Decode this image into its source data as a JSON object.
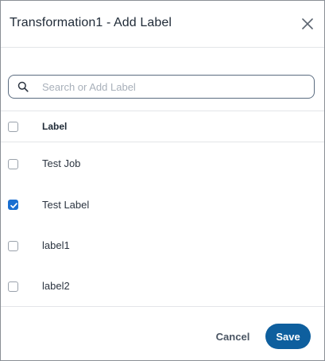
{
  "dialog": {
    "title": "Transformation1 - Add Label"
  },
  "search": {
    "value": "",
    "placeholder": "Search or Add Label"
  },
  "table": {
    "column_header": "Label",
    "header_checked": false,
    "rows": [
      {
        "label": "Test Job",
        "checked": false
      },
      {
        "label": "Test Label",
        "checked": true
      },
      {
        "label": "label1",
        "checked": false
      },
      {
        "label": "label2",
        "checked": false
      }
    ]
  },
  "footer": {
    "cancel_label": "Cancel",
    "save_label": "Save"
  },
  "icons": {
    "close": "close-icon",
    "search": "search-icon",
    "check": "check-icon"
  },
  "colors": {
    "primary": "#0e5f9e",
    "checkbox_checked": "#1a6fd1",
    "border": "#8a8f96",
    "divider": "#e3e5e8"
  }
}
